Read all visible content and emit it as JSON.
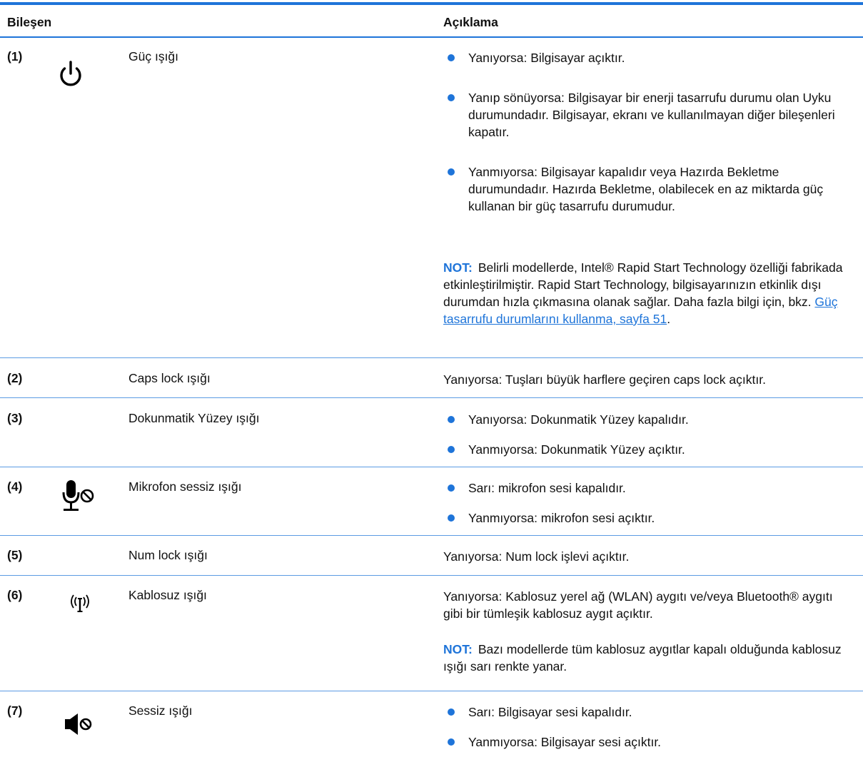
{
  "header": {
    "component": "Bileşen",
    "description": "Açıklama"
  },
  "rows": [
    {
      "num": "(1)",
      "name": "Güç ışığı",
      "icon": "power-icon",
      "bullets": [
        "Yanıyorsa: Bilgisayar açıktır.",
        "Yanıp sönüyorsa: Bilgisayar bir enerji tasarrufu durumu olan Uyku durumundadır. Bilgisayar, ekranı ve kullanılmayan diğer bileşenleri kapatır.",
        "Yanmıyorsa: Bilgisayar kapalıdır veya Hazırda Bekletme durumundadır. Hazırda Bekletme, olabilecek en az miktarda güç kullanan bir güç tasarrufu durumudur."
      ],
      "note": {
        "label": "NOT:",
        "text": "Belirli modellerde, Intel® Rapid Start Technology özelliği fabrikada etkinleştirilmiştir. Rapid Start Technology, bilgisayarınızın etkinlik dışı durumdan hızla çıkmasına olanak sağlar. Daha fazla bilgi için, bkz. ",
        "link": "Güç tasarrufu durumlarını kullanma, sayfa 51",
        "after": "."
      }
    },
    {
      "num": "(2)",
      "name": "Caps lock ışığı",
      "desc": "Yanıyorsa: Tuşları büyük harflere geçiren caps lock açıktır."
    },
    {
      "num": "(3)",
      "name": "Dokunmatik Yüzey ışığı",
      "bullets": [
        "Yanıyorsa: Dokunmatik Yüzey kapalıdır.",
        "Yanmıyorsa: Dokunmatik Yüzey açıktır."
      ]
    },
    {
      "num": "(4)",
      "name": "Mikrofon sessiz ışığı",
      "icon": "microphone-mute-icon",
      "bullets": [
        "Sarı: mikrofon sesi kapalıdır.",
        "Yanmıyorsa: mikrofon sesi açıktır."
      ]
    },
    {
      "num": "(5)",
      "name": "Num lock ışığı",
      "desc": "Yanıyorsa: Num lock işlevi açıktır."
    },
    {
      "num": "(6)",
      "name": "Kablosuz ışığı",
      "icon": "wireless-icon",
      "desc": "Yanıyorsa: Kablosuz yerel ağ (WLAN) aygıtı ve/veya Bluetooth® aygıtı gibi bir tümleşik kablosuz aygıt açıktır.",
      "note": {
        "label": "NOT:",
        "text": "Bazı modellerde tüm kablosuz aygıtlar kapalı olduğunda kablosuz ışığı sarı renkte yanar."
      }
    },
    {
      "num": "(7)",
      "name": "Sessiz ışığı",
      "icon": "speaker-mute-icon",
      "bullets": [
        "Sarı: Bilgisayar sesi kapalıdır.",
        "Yanmıyorsa: Bilgisayar sesi açıktır."
      ]
    }
  ],
  "colors": {
    "accent": "#1e74d9",
    "text": "#111111"
  }
}
